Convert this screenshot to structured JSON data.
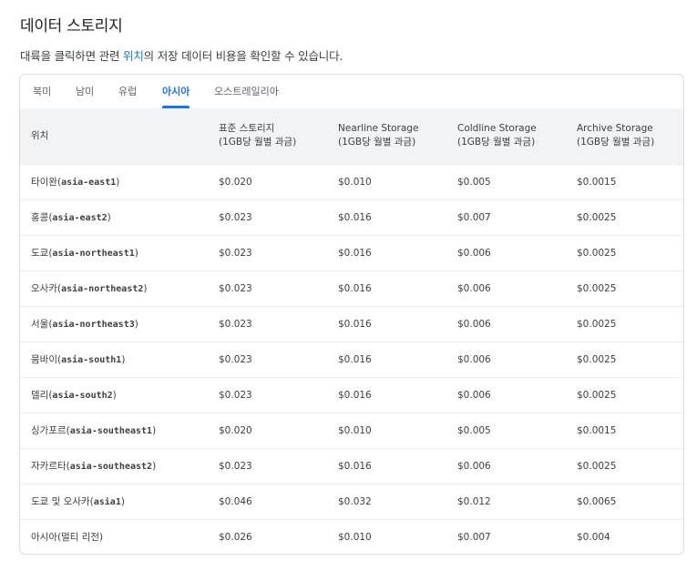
{
  "title": "데이터 스토리지",
  "intro": {
    "before": "대륙을 클릭하면 관련 ",
    "link": "위치",
    "after": "의 저장 데이터 비용을 확인할 수 있습니다."
  },
  "tabs": [
    "북미",
    "남미",
    "유럽",
    "아시아",
    "오스트레일리아"
  ],
  "active_tab": "아시아",
  "table": {
    "headers": [
      {
        "line1": "위치",
        "line2": ""
      },
      {
        "line1": "표준 스토리지",
        "line2": "(1GB당 월별 과금)"
      },
      {
        "line1": "Nearline Storage",
        "line2": "(1GB당 월별 과금)"
      },
      {
        "line1": "Coldline Storage",
        "line2": "(1GB당 월별 과금)"
      },
      {
        "line1": "Archive Storage",
        "line2": "(1GB당 월별 과금)"
      }
    ],
    "rows": [
      {
        "name": "타이완(",
        "code": "asia-east1",
        "suffix": ")",
        "standard": "$0.020",
        "nearline": "$0.010",
        "coldline": "$0.005",
        "archive": "$0.0015"
      },
      {
        "name": "홍콩(",
        "code": "asia-east2",
        "suffix": ")",
        "standard": "$0.023",
        "nearline": "$0.016",
        "coldline": "$0.007",
        "archive": "$0.0025"
      },
      {
        "name": "도쿄(",
        "code": "asia-northeast1",
        "suffix": ")",
        "standard": "$0.023",
        "nearline": "$0.016",
        "coldline": "$0.006",
        "archive": "$0.0025"
      },
      {
        "name": "오사카(",
        "code": "asia-northeast2",
        "suffix": ")",
        "standard": "$0.023",
        "nearline": "$0.016",
        "coldline": "$0.006",
        "archive": "$0.0025"
      },
      {
        "name": "서울(",
        "code": "asia-northeast3",
        "suffix": ")",
        "standard": "$0.023",
        "nearline": "$0.016",
        "coldline": "$0.006",
        "archive": "$0.0025"
      },
      {
        "name": "뭄바이(",
        "code": "asia-south1",
        "suffix": ")",
        "standard": "$0.023",
        "nearline": "$0.016",
        "coldline": "$0.006",
        "archive": "$0.0025"
      },
      {
        "name": "델리(",
        "code": "asia-south2",
        "suffix": ")",
        "standard": "$0.023",
        "nearline": "$0.016",
        "coldline": "$0.006",
        "archive": "$0.0025"
      },
      {
        "name": "싱가포르(",
        "code": "asia-southeast1",
        "suffix": ")",
        "standard": "$0.020",
        "nearline": "$0.010",
        "coldline": "$0.005",
        "archive": "$0.0015"
      },
      {
        "name": "자카르타(",
        "code": "asia-southeast2",
        "suffix": ")",
        "standard": "$0.023",
        "nearline": "$0.016",
        "coldline": "$0.006",
        "archive": "$0.0025"
      },
      {
        "name": "도쿄 및 오사카(",
        "code": "asia1",
        "suffix": ")",
        "standard": "$0.046",
        "nearline": "$0.032",
        "coldline": "$0.012",
        "archive": "$0.0065"
      },
      {
        "name": "아시아(멀티 리전)",
        "code": "",
        "suffix": "",
        "standard": "$0.026",
        "nearline": "$0.010",
        "coldline": "$0.007",
        "archive": "$0.004"
      }
    ]
  },
  "colors": {
    "accent": "#1a73e8",
    "header_bg": "#f1f3f4",
    "border": "#dadce0",
    "text": "#3c4043"
  }
}
